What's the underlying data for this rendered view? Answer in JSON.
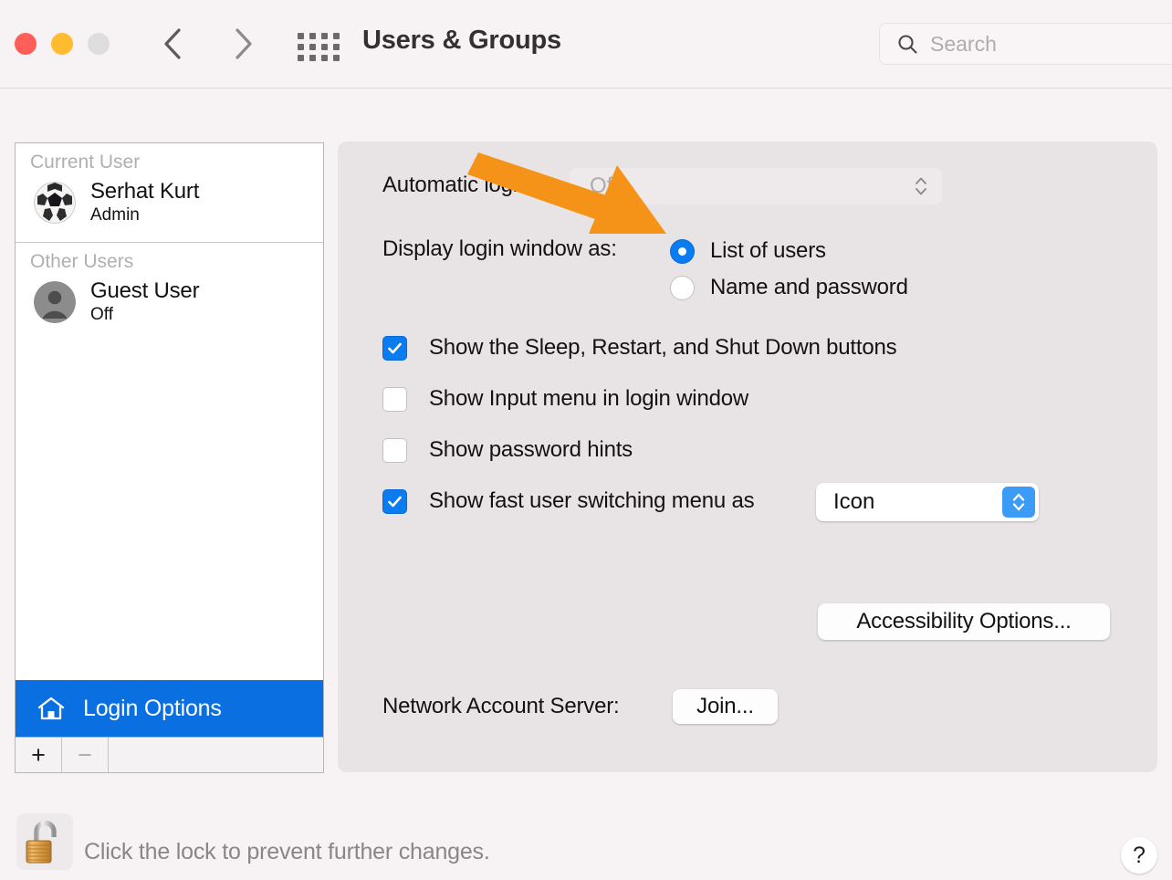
{
  "window": {
    "title": "Users & Groups",
    "traffic_lights": [
      {
        "name": "close",
        "color": "#ff5f56"
      },
      {
        "name": "minimize",
        "color": "#febc2e"
      },
      {
        "name": "zoom",
        "color": "#dedede"
      }
    ],
    "nav": {
      "back_icon": "chevron-left",
      "forward_icon": "chevron-right",
      "grid_icon": "grid-view-icon"
    }
  },
  "search": {
    "icon": "search-icon",
    "placeholder": "Search",
    "value": ""
  },
  "sidebar": {
    "groups": [
      {
        "header": "Current User",
        "users": [
          {
            "name": "Serhat Kurt",
            "role": "Admin",
            "avatar": "soccer-ball-avatar"
          }
        ]
      },
      {
        "header": "Other Users",
        "users": [
          {
            "name": "Guest User",
            "role": "Off",
            "avatar": "generic-person-avatar"
          }
        ]
      }
    ],
    "login_options": {
      "label": "Login Options",
      "icon": "house-icon",
      "selected": true,
      "highlight_color": "#0a6fe0"
    },
    "toolbar": {
      "add_label": "+",
      "remove_label": "−",
      "remove_disabled": true
    }
  },
  "main": {
    "automatic_login": {
      "label": "Automatic login:",
      "value": "Off",
      "disabled": true,
      "options": [
        "Off"
      ]
    },
    "display_login_window": {
      "label": "Display login window as:",
      "options": [
        {
          "label": "List of users",
          "selected": true
        },
        {
          "label": "Name and password",
          "selected": false
        }
      ]
    },
    "checkboxes": [
      {
        "label": "Show the Sleep, Restart, and Shut Down buttons",
        "checked": true
      },
      {
        "label": "Show Input menu in login window",
        "checked": false
      },
      {
        "label": "Show password hints",
        "checked": false
      },
      {
        "label": "Show fast user switching menu as",
        "checked": true
      }
    ],
    "fast_user_switching": {
      "value": "Icon",
      "options": [
        "Icon"
      ]
    },
    "accessibility_options_button": "Accessibility Options...",
    "network_account_server": {
      "label": "Network Account Server:",
      "join_button": "Join..."
    }
  },
  "footer": {
    "lock": {
      "icon": "open-padlock-icon",
      "message": "Click the lock to prevent further changes."
    },
    "help_button": "?"
  },
  "annotation": {
    "arrow_color": "#f59319",
    "points_to": "List of users"
  }
}
